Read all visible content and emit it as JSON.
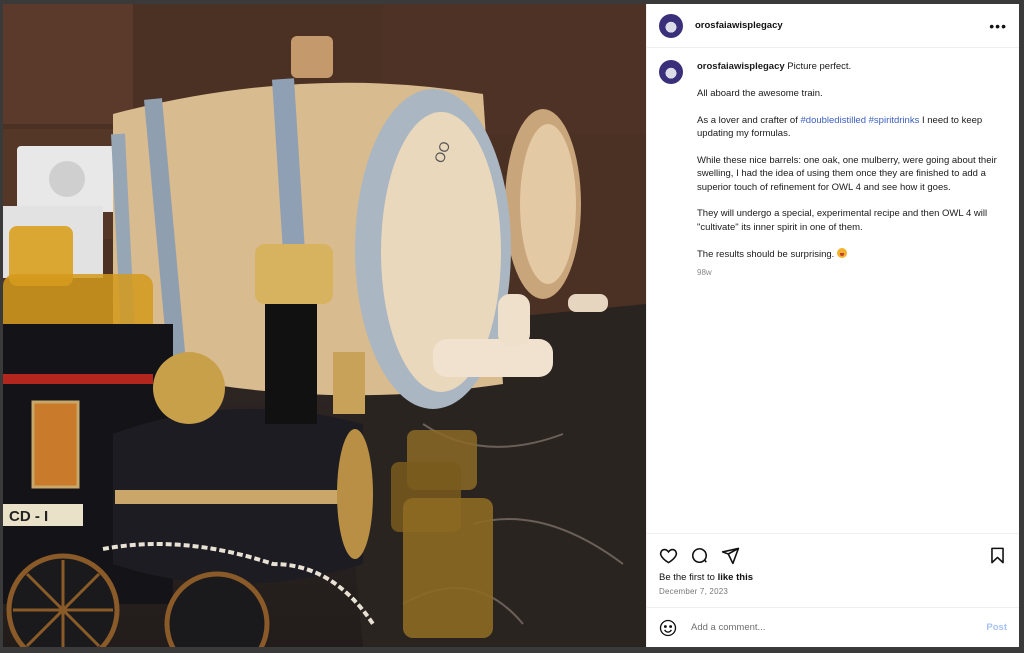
{
  "post": {
    "username": "orosfaiawisplegacy",
    "more_icon": "more-horizontal-icon"
  },
  "caption": {
    "username": "orosfaiawisplegacy",
    "first_line": "Picture perfect.",
    "p2": "All aboard the awesome train.",
    "p3_before": "As a lover and crafter of ",
    "hashtag1": "#doubledistilled",
    "hashtag2": "#spiritdrinks",
    "p3_after": " I need to keep updating my formulas.",
    "p4": "While these nice barrels: one oak, one mulberry, were going about their swelling, I had the idea of using them once they are finished to add a superior touch of refinement for OWL 4 and see how it goes.",
    "p5": "They will undergo a special, experimental recipe and then OWL 4 will \"cultivate\" its inner spirit in one of them.",
    "p6": "The results should be surprising.",
    "emoji": "astonished-face-emoji",
    "time_ago": "98w"
  },
  "actions": {
    "icons": [
      "heart-icon",
      "comment-icon",
      "share-icon",
      "bookmark-icon"
    ],
    "likes_prefix": "Be the first to ",
    "likes_link": "like this",
    "date": "December 7, 2023"
  },
  "comment_bar": {
    "emoji_icon": "smiley-icon",
    "placeholder": "Add a comment...",
    "post_label": "Post"
  },
  "colors": {
    "link": "#3b5fbf",
    "post_button": "#a7c3f5"
  }
}
